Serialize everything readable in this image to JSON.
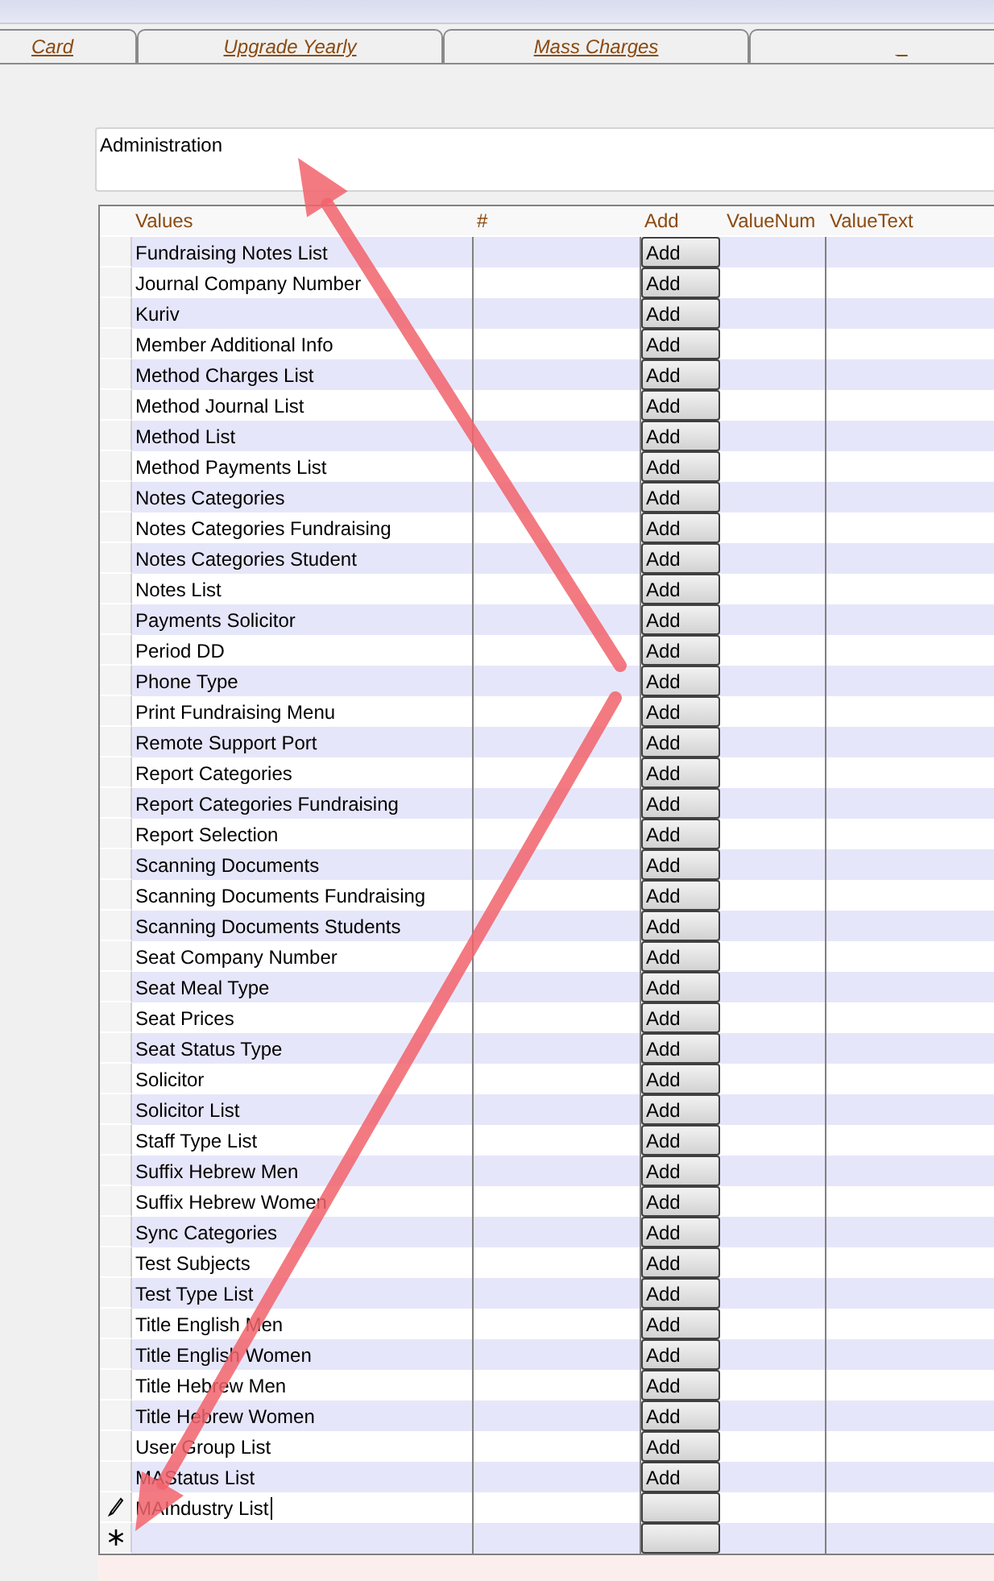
{
  "tabs": [
    {
      "label": "Card",
      "selected": false
    },
    {
      "label": "Upgrade Yearly",
      "selected": false
    },
    {
      "label": "Mass Charges",
      "selected": false
    },
    {
      "label": "_",
      "selected": false
    }
  ],
  "category_field": {
    "value": "Administration"
  },
  "table": {
    "columns": [
      "Values",
      "#",
      "Add",
      "ValueNum",
      "ValueText"
    ],
    "rows": [
      {
        "kind": "record",
        "value": "Fundraising Notes List",
        "button": "Add"
      },
      {
        "kind": "record",
        "value": "Journal Company Number",
        "button": "Add"
      },
      {
        "kind": "record",
        "value": "Kuriv",
        "button": "Add"
      },
      {
        "kind": "record",
        "value": "Member Additional Info",
        "button": "Add"
      },
      {
        "kind": "record",
        "value": "Method Charges List",
        "button": "Add"
      },
      {
        "kind": "record",
        "value": "Method Journal List",
        "button": "Add"
      },
      {
        "kind": "record",
        "value": "Method List",
        "button": "Add"
      },
      {
        "kind": "record",
        "value": "Method Payments List",
        "button": "Add"
      },
      {
        "kind": "record",
        "value": "Notes Categories",
        "button": "Add"
      },
      {
        "kind": "record",
        "value": "Notes Categories Fundraising",
        "button": "Add"
      },
      {
        "kind": "record",
        "value": "Notes Categories Student",
        "button": "Add"
      },
      {
        "kind": "record",
        "value": "Notes List",
        "button": "Add"
      },
      {
        "kind": "record",
        "value": "Payments Solicitor",
        "button": "Add"
      },
      {
        "kind": "record",
        "value": "Period DD",
        "button": "Add"
      },
      {
        "kind": "record",
        "value": "Phone Type",
        "button": "Add"
      },
      {
        "kind": "record",
        "value": "Print Fundraising Menu",
        "button": "Add"
      },
      {
        "kind": "record",
        "value": "Remote Support Port",
        "button": "Add"
      },
      {
        "kind": "record",
        "value": "Report Categories",
        "button": "Add"
      },
      {
        "kind": "record",
        "value": "Report Categories Fundraising",
        "button": "Add"
      },
      {
        "kind": "record",
        "value": "Report Selection",
        "button": "Add"
      },
      {
        "kind": "record",
        "value": "Scanning Documents",
        "button": "Add"
      },
      {
        "kind": "record",
        "value": "Scanning Documents Fundraising",
        "button": "Add"
      },
      {
        "kind": "record",
        "value": "Scanning Documents Students",
        "button": "Add"
      },
      {
        "kind": "record",
        "value": "Seat Company Number",
        "button": "Add"
      },
      {
        "kind": "record",
        "value": "Seat Meal Type",
        "button": "Add"
      },
      {
        "kind": "record",
        "value": "Seat Prices",
        "button": "Add"
      },
      {
        "kind": "record",
        "value": "Seat Status Type",
        "button": "Add"
      },
      {
        "kind": "record",
        "value": "Solicitor",
        "button": "Add"
      },
      {
        "kind": "record",
        "value": "Solicitor List",
        "button": "Add"
      },
      {
        "kind": "record",
        "value": "Staff Type List",
        "button": "Add"
      },
      {
        "kind": "record",
        "value": "Suffix Hebrew Men",
        "button": "Add"
      },
      {
        "kind": "record",
        "value": "Suffix Hebrew Women",
        "button": "Add"
      },
      {
        "kind": "record",
        "value": "Sync Categories",
        "button": "Add"
      },
      {
        "kind": "record",
        "value": "Test Subjects",
        "button": "Add"
      },
      {
        "kind": "record",
        "value": "Test Type List",
        "button": "Add"
      },
      {
        "kind": "record",
        "value": "Title English Men",
        "button": "Add"
      },
      {
        "kind": "record",
        "value": "Title English Women",
        "button": "Add"
      },
      {
        "kind": "record",
        "value": "Title Hebrew Men",
        "button": "Add"
      },
      {
        "kind": "record",
        "value": "Title Hebrew Women",
        "button": "Add"
      },
      {
        "kind": "record",
        "value": "User Group List",
        "button": "Add"
      },
      {
        "kind": "record",
        "value": "MAStatus List",
        "button": "Add"
      },
      {
        "kind": "editing",
        "value": "MAIndustry List"
      },
      {
        "kind": "new"
      }
    ]
  }
}
